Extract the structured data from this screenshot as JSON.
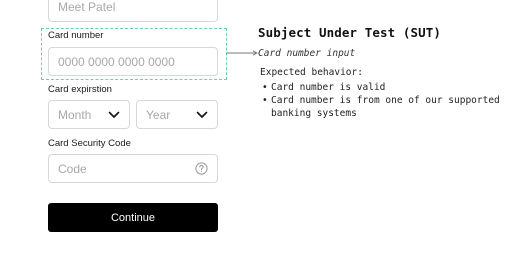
{
  "form": {
    "name_value": "Meet Patel",
    "card_number_label": "Card number",
    "card_number_placeholder": "0000 0000 0000 0000",
    "expiration_label": "Card expirstion",
    "month_placeholder": "Month",
    "year_placeholder": "Year",
    "security_code_label": "Card Security Code",
    "code_placeholder": "Code",
    "continue_label": "Continue"
  },
  "annotation": {
    "title": "Subject Under Test (SUT)",
    "subtitle": "Card number input",
    "expected_heading": "Expected behavior:",
    "expected_items": [
      "Card number is valid",
      "Card number is from one of our supported banking systems"
    ]
  },
  "icons": {
    "month_chevron": "chevron-down-icon",
    "year_chevron": "chevron-down-icon",
    "code_help": "question-circle-icon"
  },
  "colors": {
    "highlight": "#6fcfa6",
    "button_bg": "#000000",
    "button_text": "#ffffff",
    "placeholder": "#a8a8a8",
    "border": "#d7d7d7"
  }
}
